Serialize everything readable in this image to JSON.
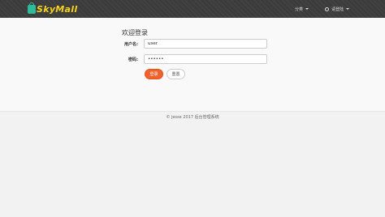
{
  "brand": {
    "name": "SkyMall"
  },
  "nav": {
    "category_label": "分类",
    "login_label": "请登陆"
  },
  "form": {
    "title": "欢迎登录",
    "username_label": "用户名:",
    "username_value": "user",
    "password_label": "密码:",
    "password_value": "••••••",
    "login_button": "登录",
    "reset_button": "重置"
  },
  "footer": {
    "text": "© jesse 2017   后台管理系统"
  },
  "icons": {
    "logo": "shopping-bag-icon",
    "user": "user-icon",
    "dropdown": "caret-down-icon"
  },
  "colors": {
    "navbar": "#3b3b3b",
    "brand_text": "#f5d21c",
    "login_button": "#f0612c"
  }
}
